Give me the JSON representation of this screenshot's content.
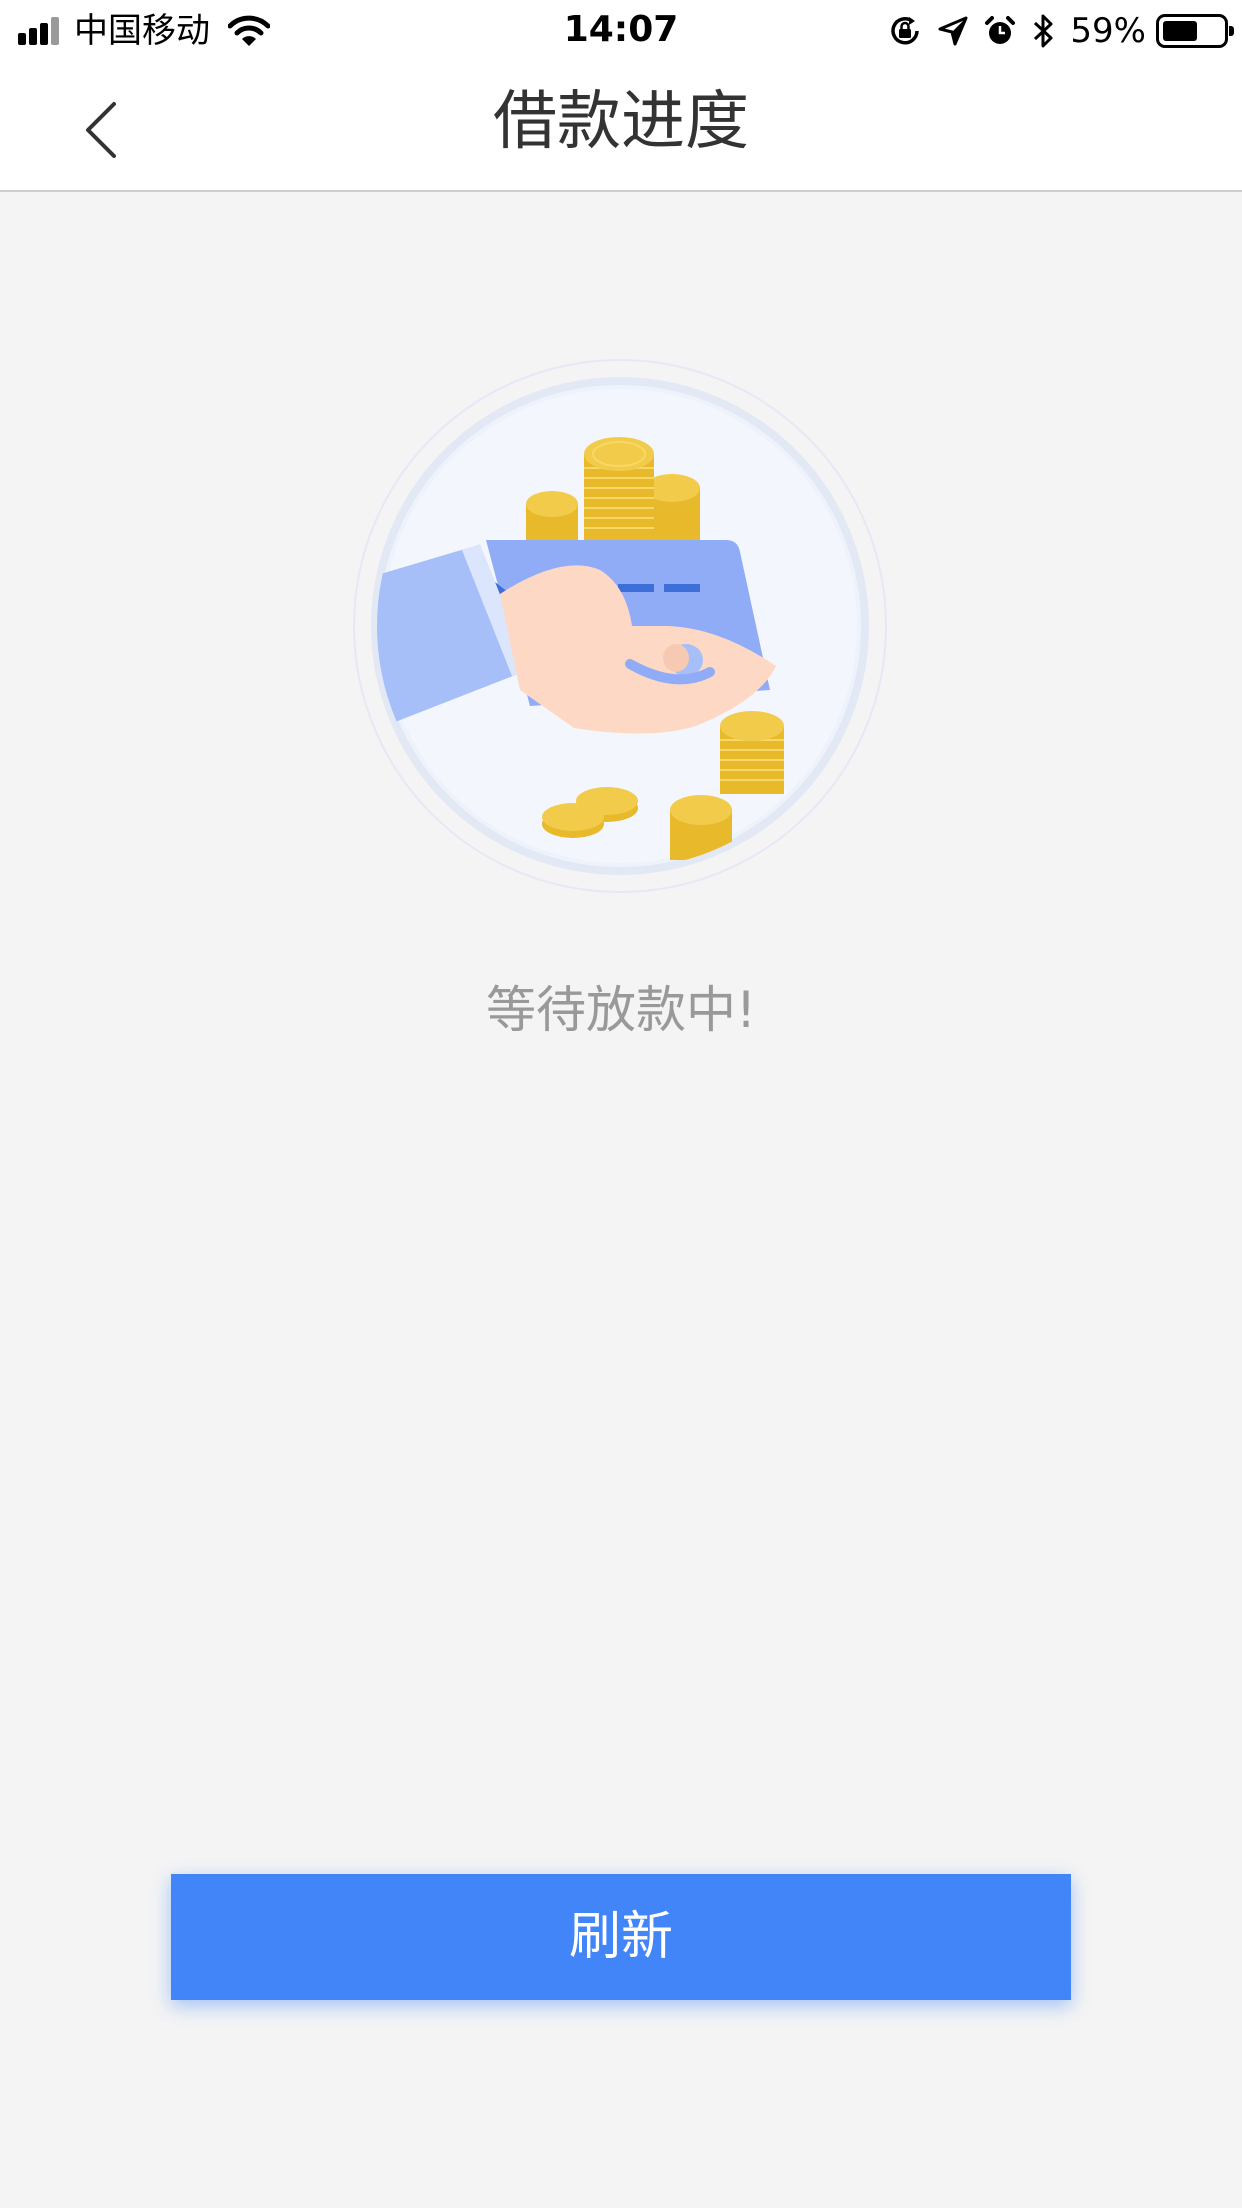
{
  "status_bar": {
    "carrier": "中国移动",
    "time": "14:07",
    "battery_percent": "59%",
    "battery_level": 0.59,
    "signal_bars": 4
  },
  "nav": {
    "title": "借款进度",
    "back_icon": "chevron-left-icon"
  },
  "main": {
    "status_text": "等待放款中!",
    "illustration": "hand-card-coins-illustration"
  },
  "actions": {
    "refresh_label": "刷新"
  },
  "colors": {
    "accent": "#4285f9",
    "status_text": "#999999",
    "title": "#333333",
    "background": "#f4f4f4"
  }
}
